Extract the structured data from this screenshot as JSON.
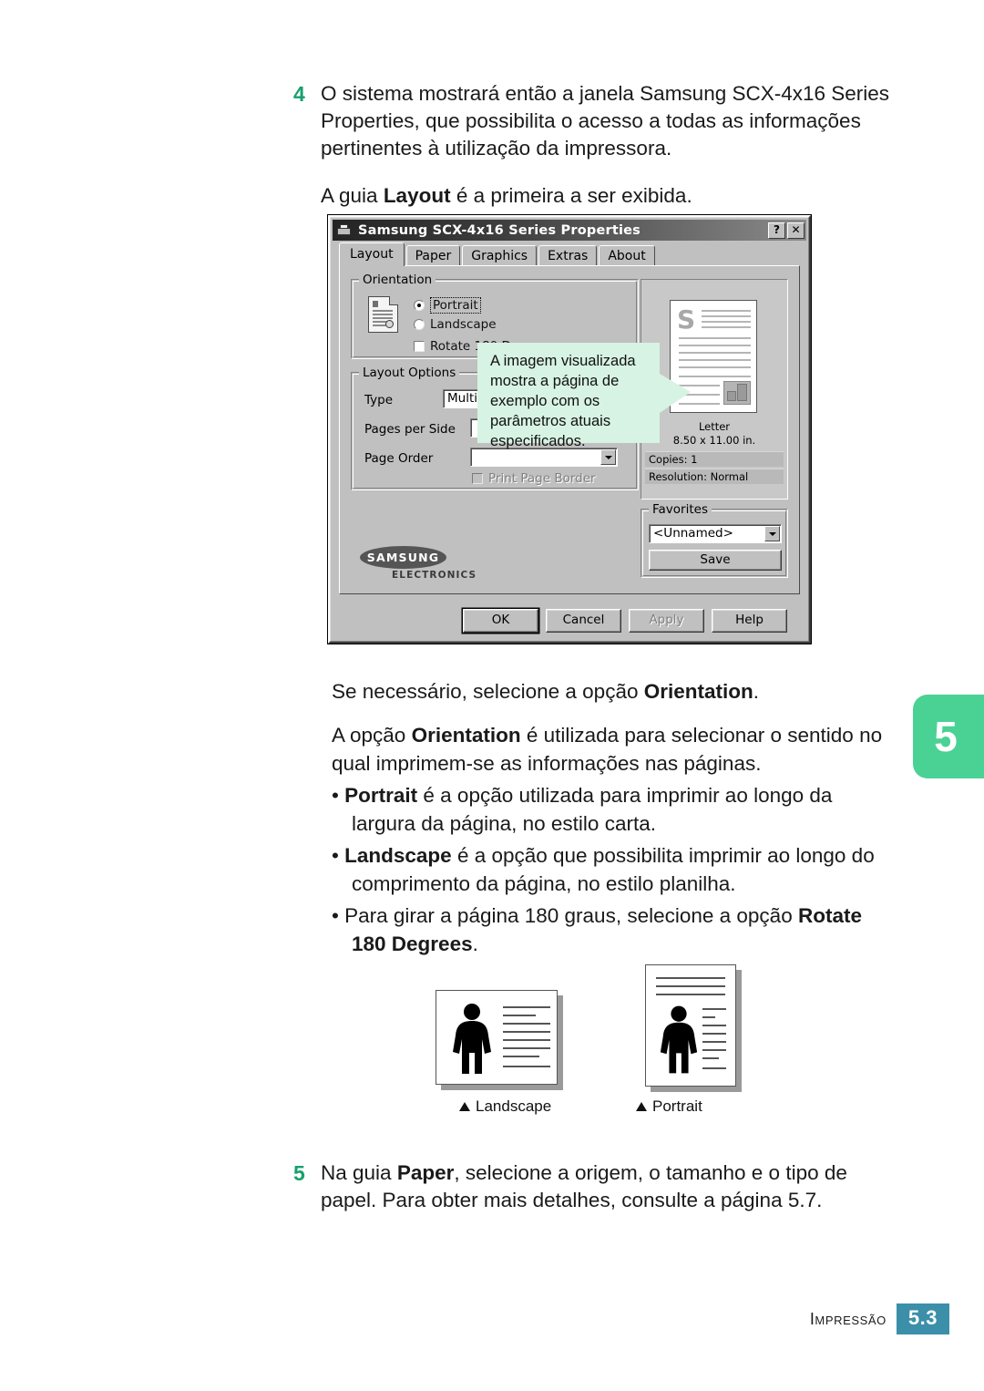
{
  "steps": [
    {
      "number": "4",
      "paragraphs": [
        "O sistema mostrará então a janela Samsung SCX-4x16 Series Properties, que possibilita o acesso a todas as informações pertinentes à utilização da impressora.",
        "A guia Layout é a primeira a ser exibida."
      ]
    },
    {
      "number": "5",
      "paragraphs": [
        "Na guia Paper, selecione a origem, o tamanho e o tipo de papel. Para obter mais detalhes, consulte a página 5.7."
      ]
    }
  ],
  "body": {
    "para_orientation": "Se necessário, selecione a opção Orientation.",
    "para_orientation_desc": "A opção Orientation é utilizada para selecionar o sentido no qual imprimem-se as informações nas páginas.",
    "bullet_portrait": "• Portrait é a opção utilizada para imprimir ao longo da largura da página, no estilo carta.",
    "bullet_landscape": "• Landscape é a opção que possibilita imprimir ao longo do comprimento da página, no estilo planilha.",
    "bullet_rotate": "• Para girar a página 180 graus, selecione a opção Rotate 180 Degrees."
  },
  "chapter_tab": {
    "label": "5",
    "color": "#4ad295"
  },
  "footer": {
    "label": "Impressão",
    "page": "5.3",
    "page_bg": "#3b8fa9"
  },
  "dialog": {
    "title": "Samsung SCX-4x16 Series Properties",
    "title_icon": "printer-icon",
    "help_button": "?",
    "close_button": "✕",
    "tabs": [
      {
        "label": "Layout",
        "active": true
      },
      {
        "label": "Paper",
        "active": false
      },
      {
        "label": "Graphics",
        "active": false
      },
      {
        "label": "Extras",
        "active": false
      },
      {
        "label": "About",
        "active": false
      }
    ],
    "orientation": {
      "group_title": "Orientation",
      "portrait_label": "Portrait",
      "portrait_selected": true,
      "landscape_label": "Landscape",
      "landscape_selected": false,
      "rotate_label": "Rotate 180 Degrees",
      "rotate_checked": false
    },
    "layout_options": {
      "group_title": "Layout Options",
      "type_label": "Type",
      "type_value": "Multiple",
      "pages_per_side_label": "Pages per Side",
      "pages_per_side_value": "",
      "page_order_label": "Page Order",
      "page_order_value": "",
      "print_page_border_label": "Print Page Border",
      "print_page_border_checked": false,
      "print_page_border_enabled": false
    },
    "preview": {
      "letter_mark": "S",
      "paper_name": "Letter",
      "paper_size": "8.50 x 11.00 in.",
      "copies": "Copies: 1",
      "resolution": "Resolution: Normal"
    },
    "favorites": {
      "group_title": "Favorites",
      "selected": "<Unnamed>",
      "save_label": "Save"
    },
    "brand": {
      "name": "SAMSUNG",
      "sub": "ELECTRONICS"
    },
    "buttons": [
      {
        "label": "OK",
        "default": true,
        "enabled": true
      },
      {
        "label": "Cancel",
        "default": false,
        "enabled": true
      },
      {
        "label": "Apply",
        "default": false,
        "enabled": false
      },
      {
        "label": "Help",
        "default": false,
        "enabled": true
      }
    ]
  },
  "callout": {
    "text": "A imagem visualizada mostra a página de exemplo com os parâmetros atuais especificados.",
    "bg": "#d7f3e3"
  },
  "figures": [
    {
      "caption": "Landscape"
    },
    {
      "caption": "Portrait"
    }
  ]
}
